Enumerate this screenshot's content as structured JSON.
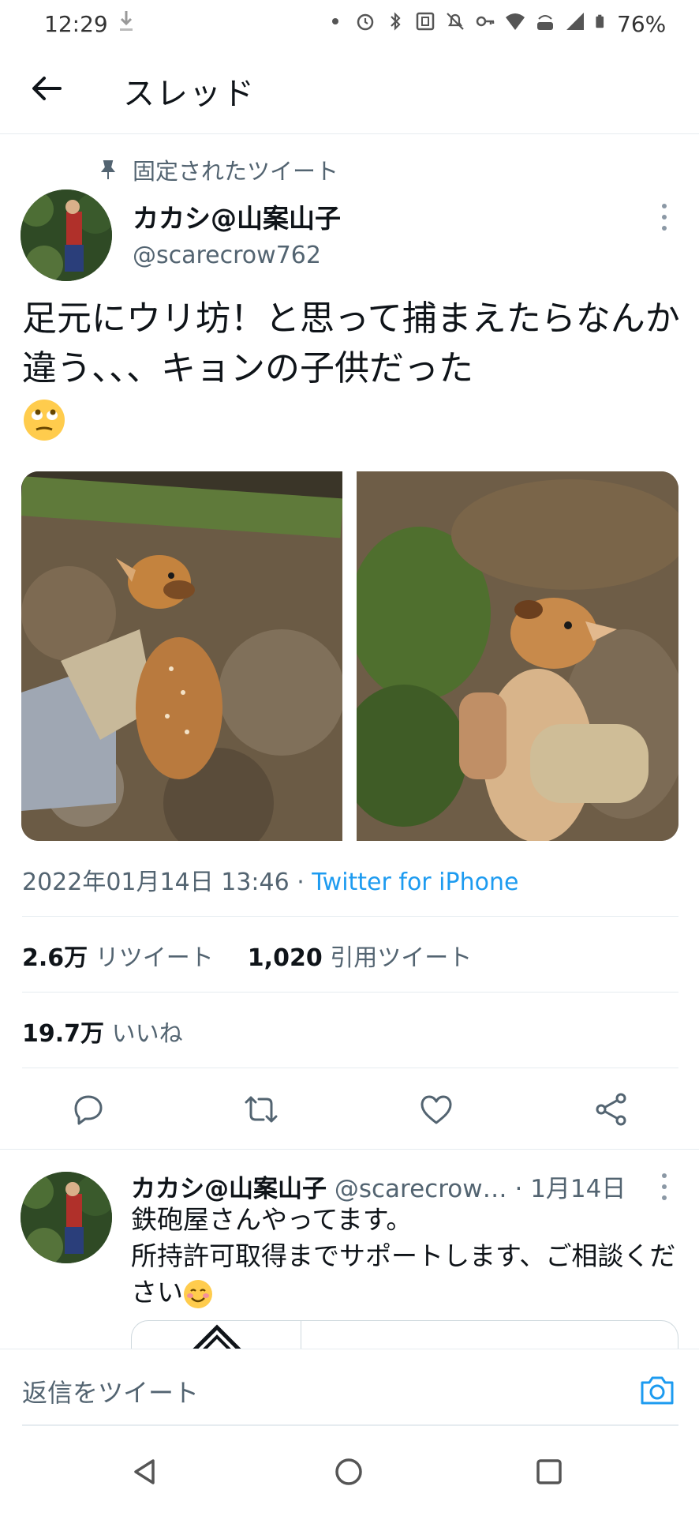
{
  "status_bar": {
    "time": "12:29",
    "battery": "76%",
    "icons": [
      "download-icon",
      "dot-icon",
      "alarm-icon",
      "bluetooth-icon",
      "nfc-icon",
      "mute-icon",
      "vpn-key-icon",
      "wifi-icon",
      "volte-icon",
      "signal-icon",
      "battery-icon"
    ]
  },
  "header": {
    "title": "スレッド",
    "back_icon": "arrow-left-icon"
  },
  "pinned_label": "固定されたツイート",
  "tweet": {
    "author_name": "カカシ@山案山子",
    "author_handle": "@scarecrow762",
    "text": "足元にウリ坊！と思って捕まえたらなんか違う、、、キョンの子供だった",
    "emoji": "face-with-rolling-eyes",
    "timestamp": "2022年01月14日 13:46 · ",
    "source": "Twitter for iPhone",
    "retweets_count": "2.6万",
    "retweets_label": "リツイート",
    "quotes_count": "1,020",
    "quotes_label": "引用ツイート",
    "likes_count": "19.7万",
    "likes_label": "いいね"
  },
  "actions": [
    "reply-icon",
    "retweet-icon",
    "like-icon",
    "share-icon"
  ],
  "reply": {
    "author_name": "カカシ@山案山子",
    "author_handle": "@scarecrow…",
    "date": "· 1月14日",
    "line1": "鉄砲屋さんやってます。",
    "line2": "所持許可取得までサポートします、ご相談ください",
    "emoji": "smiling-face"
  },
  "reply_bar": {
    "placeholder": "返信をツイート"
  },
  "colors": {
    "accent": "#1d9bf0",
    "secondary_text": "#536471",
    "divider": "#e6ecf0"
  }
}
